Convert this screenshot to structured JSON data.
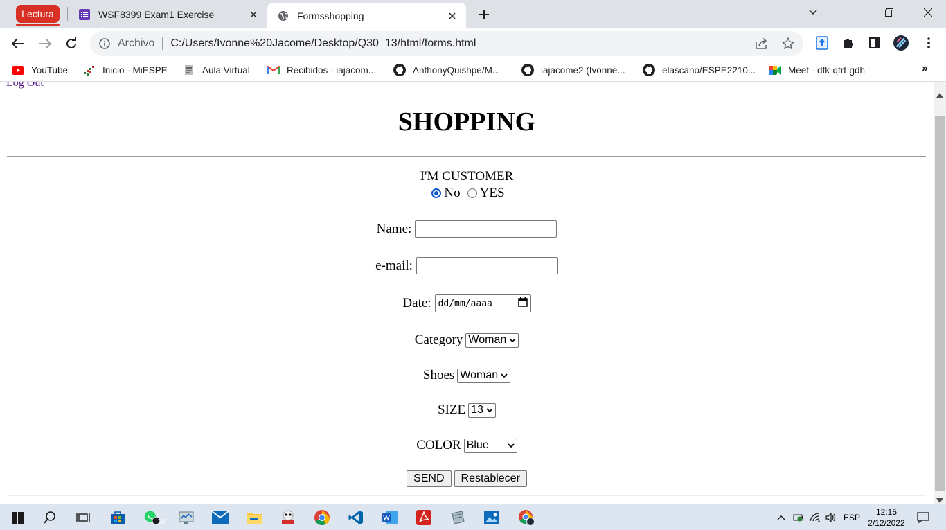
{
  "browser": {
    "reading_mode_label": "Lectura",
    "tabs": [
      {
        "title": "WSF8399 Exam1 Exercise",
        "icon": "forms-icon",
        "active": false
      },
      {
        "title": "Formsshopping",
        "icon": "globe-icon",
        "active": true
      }
    ],
    "omnibox": {
      "scheme_label": "Archivo",
      "url": "C:/Users/Ivonne%20Jacome/Desktop/Q30_13/html/forms.html"
    },
    "bookmarks": [
      {
        "label": "YouTube",
        "icon": "youtube-icon"
      },
      {
        "label": "Inicio - MiESPE",
        "icon": "espe-icon"
      },
      {
        "label": "Aula Virtual",
        "icon": "aula-icon"
      },
      {
        "label": "Recibidos - iajacom...",
        "icon": "gmail-icon"
      },
      {
        "label": "AnthonyQuishpe/M...",
        "icon": "github-icon"
      },
      {
        "label": "iajacome2 (Ivonne...",
        "icon": "github-icon"
      },
      {
        "label": "elascano/ESPE2210...",
        "icon": "github-icon"
      },
      {
        "label": "Meet - dfk-qtrt-gdh",
        "icon": "meet-icon"
      }
    ],
    "bookmarks_overflow": "»",
    "accent_color": "#d93025"
  },
  "page": {
    "cut_link": "Log Out",
    "heading": "SHOPPING",
    "customer_label": "I'M CUSTOMER",
    "radio_no": {
      "label": "No",
      "checked": true
    },
    "radio_yes": {
      "label": "YES",
      "checked": false
    },
    "name_label": "Name:",
    "name_value": "",
    "email_label": "e-mail:",
    "email_value": "",
    "date_label": "Date:",
    "date_placeholder": "dd/mm/aaaa",
    "category_label": "Category",
    "category_value": "Woman",
    "shoes_label": "Shoes",
    "shoes_value": "Woman",
    "size_label": "SIZE",
    "size_value": "13",
    "color_label": "COLOR",
    "color_value": "Blue",
    "send_button": "SEND",
    "reset_button": "Restablecer"
  },
  "taskbar": {
    "whatsapp_badge": "10",
    "language": "ESP",
    "time": "12:15",
    "date": "2/12/2022"
  }
}
